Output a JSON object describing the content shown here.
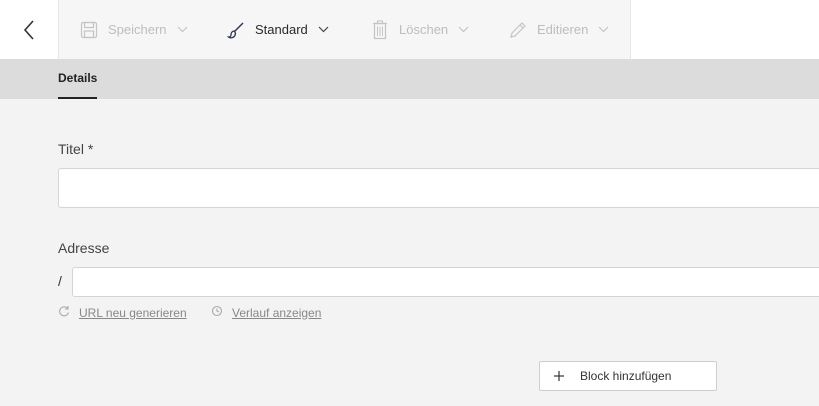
{
  "toolbar": {
    "save_label": "Speichern",
    "style_label": "Standard",
    "delete_label": "Löschen",
    "edit_label": "Editieren"
  },
  "tabs": [
    {
      "label": "Details",
      "active": true
    }
  ],
  "form": {
    "title": {
      "label": "Titel *",
      "value": ""
    },
    "address": {
      "label": "Adresse",
      "prefix": "/",
      "value": ""
    },
    "regen_url_label": "URL neu generieren",
    "history_label": "Verlauf anzeigen"
  },
  "add_block_label": "Block hinzufügen",
  "colors": {
    "toolbar_bg": "#ffffff",
    "tabbar_bg": "#dcdcdc",
    "page_bg": "#f3f3f3",
    "disabled_text": "#bdbdbd"
  },
  "icons": [
    "back-icon",
    "save-icon",
    "brush-icon",
    "trash-icon",
    "pencil-icon",
    "chevron-down-icon",
    "refresh-icon",
    "history-icon",
    "plus-icon"
  ]
}
